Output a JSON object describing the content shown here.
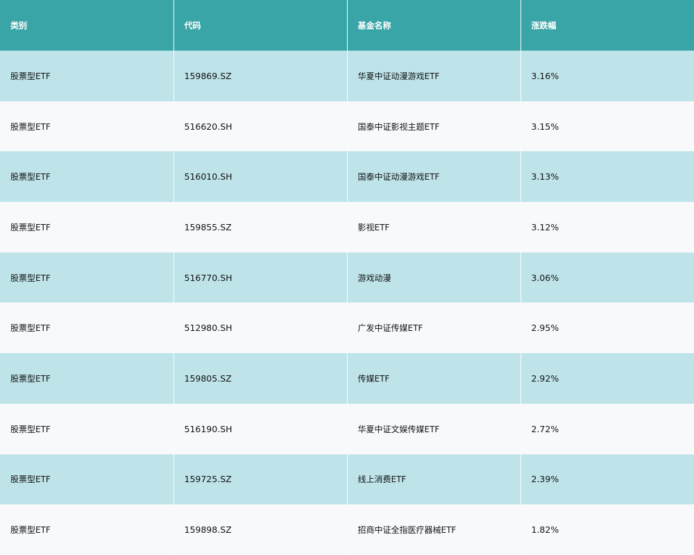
{
  "table": {
    "headers": [
      "类别",
      "代码",
      "基金名称",
      "涨跌幅"
    ],
    "rows": [
      [
        "股票型ETF",
        "159869.SZ",
        "华夏中证动漫游戏ETF",
        "3.16%"
      ],
      [
        "股票型ETF",
        "516620.SH",
        "国泰中证影视主题ETF",
        "3.15%"
      ],
      [
        "股票型ETF",
        "516010.SH",
        "国泰中证动漫游戏ETF",
        "3.13%"
      ],
      [
        "股票型ETF",
        "159855.SZ",
        "影视ETF",
        "3.12%"
      ],
      [
        "股票型ETF",
        "516770.SH",
        "游戏动漫",
        "3.06%"
      ],
      [
        "股票型ETF",
        "512980.SH",
        "广发中证传媒ETF",
        "2.95%"
      ],
      [
        "股票型ETF",
        "159805.SZ",
        "传媒ETF",
        "2.92%"
      ],
      [
        "股票型ETF",
        "516190.SH",
        "华夏中证文娱传媒ETF",
        "2.72%"
      ],
      [
        "股票型ETF",
        "159725.SZ",
        "线上消费ETF",
        "2.39%"
      ],
      [
        "股票型ETF",
        "159898.SZ",
        "招商中证全指医疗器械ETF",
        "1.82%"
      ]
    ]
  },
  "colors": {
    "header_bg": "#3aa5a7",
    "row_odd_bg": "#bee4ea",
    "row_even_bg": "#f7f9fb"
  }
}
